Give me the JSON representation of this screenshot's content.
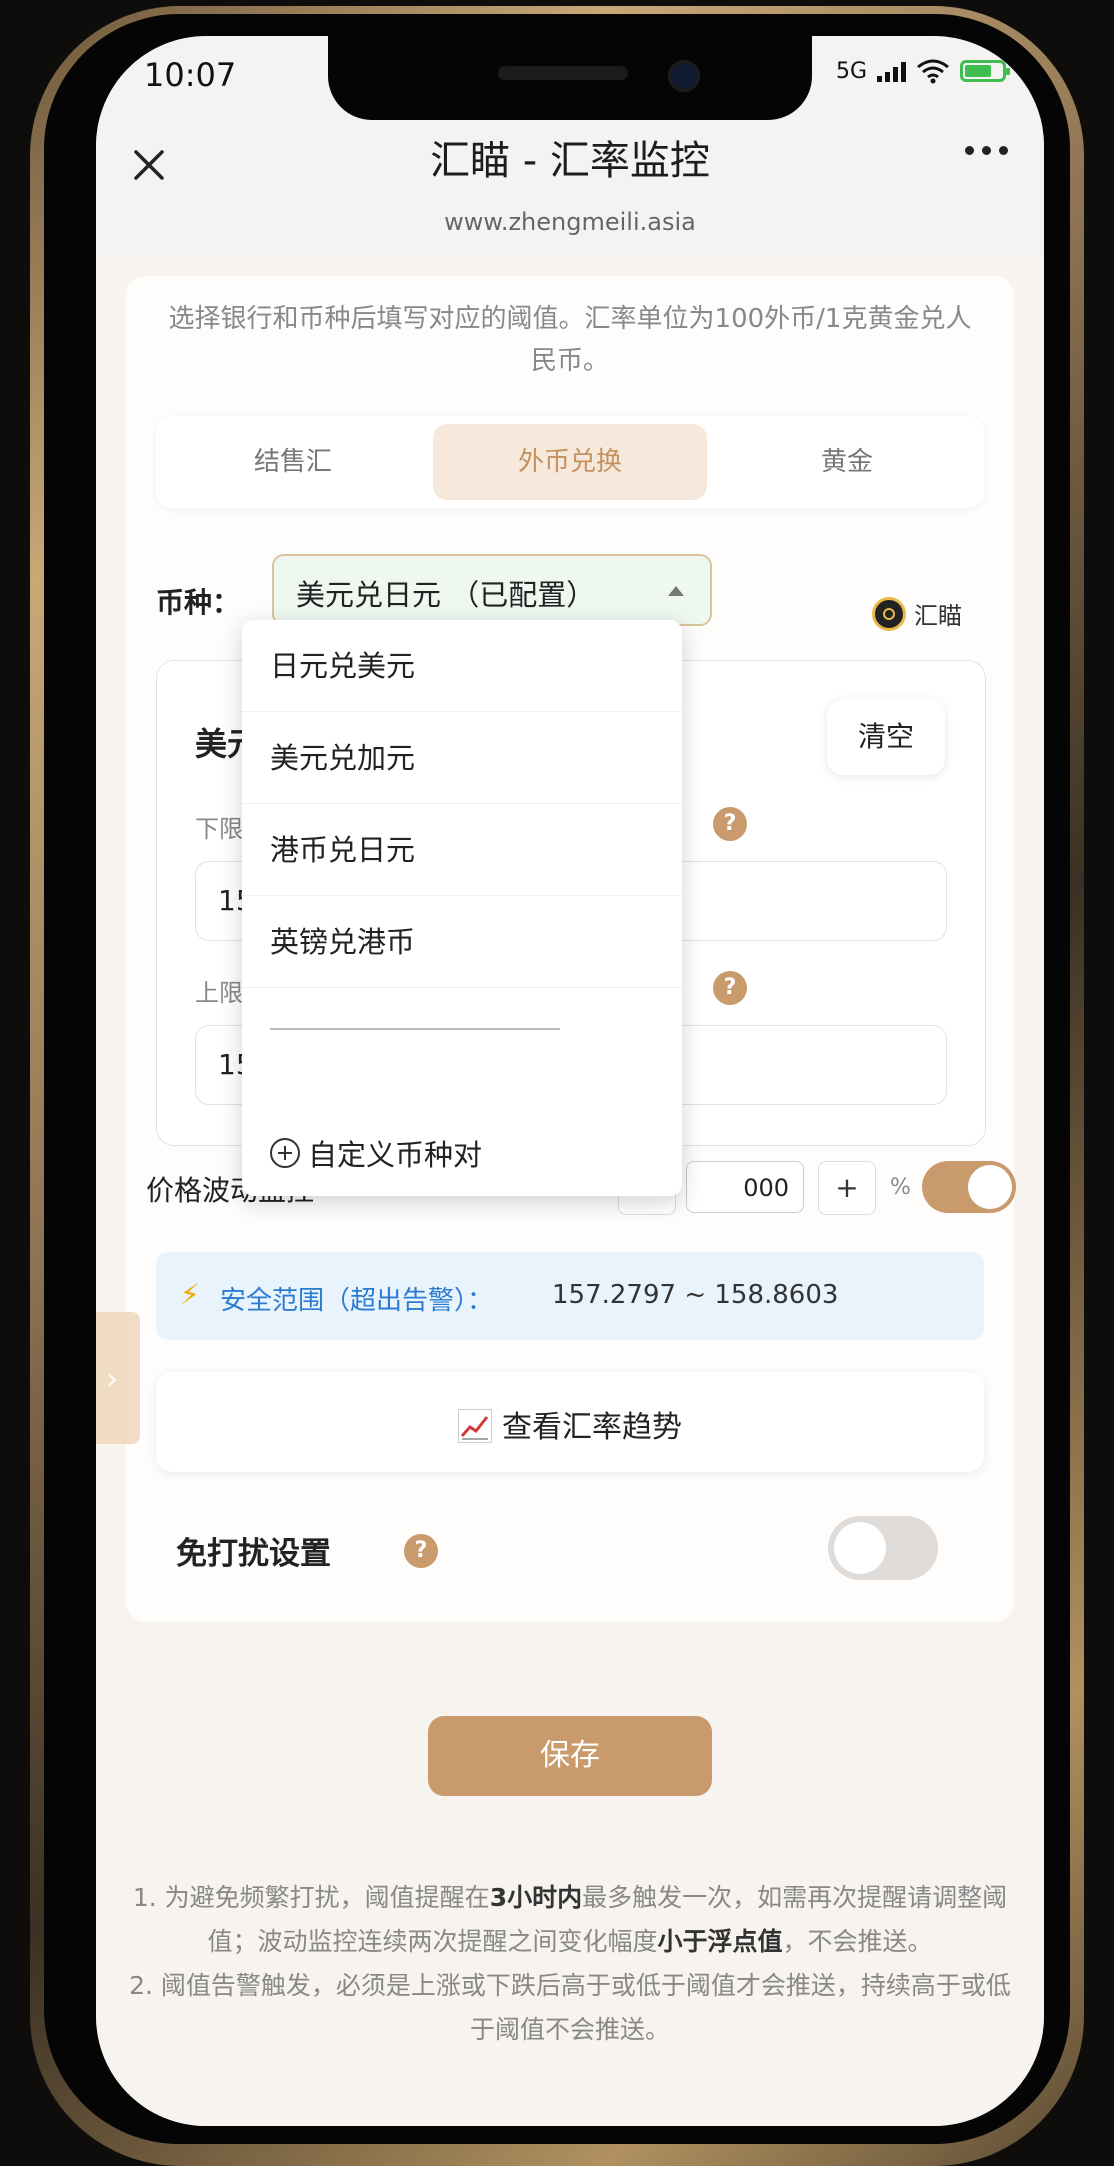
{
  "status_bar": {
    "time": "10:07",
    "network": "5G"
  },
  "header": {
    "title": "汇瞄 - 汇率监控",
    "url": "www.zhengmeili.asia"
  },
  "hint": "选择银行和币种后填写对应的阈值。汇率单位为100外币/1克黄金兑人民币。",
  "tabs": [
    {
      "label": "结售汇"
    },
    {
      "label": "外币兑换"
    },
    {
      "label": "黄金"
    }
  ],
  "currency": {
    "label": "币种：",
    "selected": "美元兑日元 （已配置）"
  },
  "watermark": "汇瞄",
  "threshold": {
    "pair_title": "美元",
    "clear_label": "清空",
    "lower_label": "下限阈",
    "lower_value": "154.",
    "upper_label": "上限阈",
    "upper_value": "155"
  },
  "fluctuation": {
    "label": "价格波动监控",
    "value": "000",
    "plus": "+",
    "unit": "%",
    "enabled": true
  },
  "safe_range": {
    "label": "安全范围（超出告警）：",
    "value": "157.2797 ~ 158.8603"
  },
  "trend_button": "查看汇率趋势",
  "dnd": {
    "label": "免打扰设置",
    "enabled": false
  },
  "save_label": "保存",
  "notes": {
    "n1_a": "1. 为避免频繁打扰，阈值提醒在",
    "n1_b": "3小时内",
    "n1_c": "最多触发一次，如需再次提醒请调整阈值；波动监控连续两次提醒之间变化幅度",
    "n1_d": "小于浮点值",
    "n1_e": "，不会推送。",
    "n2": "2. 阈值告警触发，必须是上涨或下跌后高于或低于阈值才会推送，持续高于或低于阈值不会推送。"
  },
  "dropdown": {
    "items": [
      "日元兑美元",
      "美元兑加元",
      "港币兑日元",
      "英镑兑港币"
    ],
    "custom": "自定义币种对"
  },
  "colors": {
    "accent": "#c99a6b",
    "tab_active_bg": "#f6e8da",
    "safe_bg": "#e8f3fb",
    "safe_text": "#2b7bd3"
  }
}
